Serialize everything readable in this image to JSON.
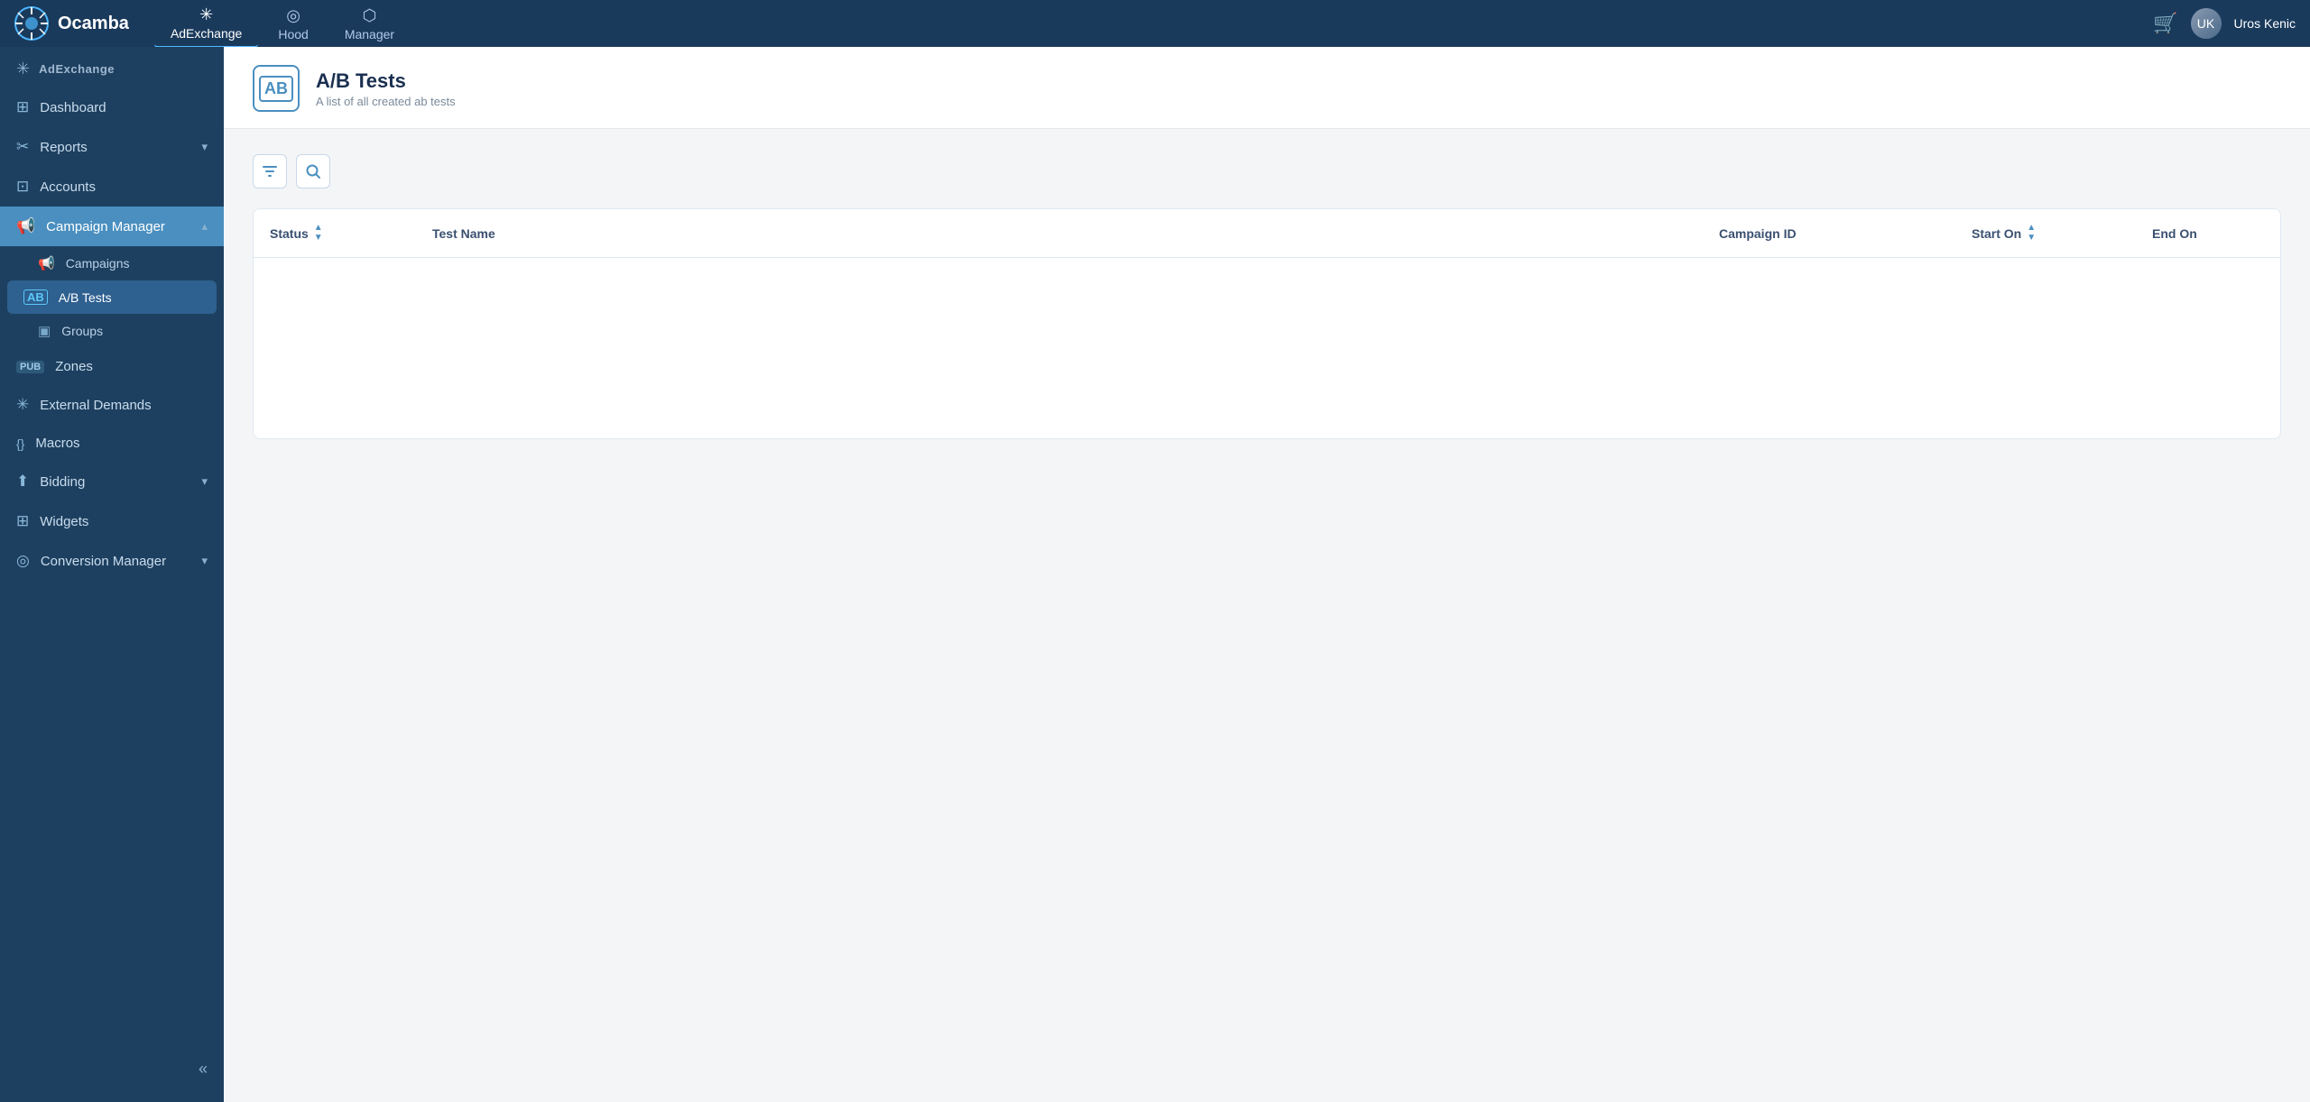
{
  "app": {
    "name": "Ocamba"
  },
  "top_nav": {
    "items": [
      {
        "id": "adexchange",
        "label": "AdExchange",
        "icon": "✳",
        "active": true
      },
      {
        "id": "hood",
        "label": "Hood",
        "icon": "◎"
      },
      {
        "id": "manager",
        "label": "Manager",
        "icon": "⬡"
      }
    ],
    "cart_label": "cart",
    "user_name": "Uros Kenic"
  },
  "sidebar": {
    "section_title": "AdExchange",
    "items": [
      {
        "id": "dashboard",
        "label": "Dashboard",
        "icon": "⊞",
        "active": false
      },
      {
        "id": "reports",
        "label": "Reports",
        "icon": "✂",
        "active": false,
        "has_arrow": true
      },
      {
        "id": "accounts",
        "label": "Accounts",
        "icon": "⊡",
        "active": false
      },
      {
        "id": "campaign-manager",
        "label": "Campaign Manager",
        "icon": "📢",
        "active": true,
        "has_arrow": true,
        "children": [
          {
            "id": "campaigns",
            "label": "Campaigns",
            "icon": "📢"
          },
          {
            "id": "ab-tests",
            "label": "A/B Tests",
            "icon": "AB",
            "active": true
          },
          {
            "id": "groups",
            "label": "Groups",
            "icon": "▣"
          }
        ]
      },
      {
        "id": "zones",
        "label": "Zones",
        "icon": "PUB",
        "active": false
      },
      {
        "id": "external-demands",
        "label": "External Demands",
        "icon": "✳",
        "active": false
      },
      {
        "id": "macros",
        "label": "Macros",
        "icon": "{}",
        "active": false
      },
      {
        "id": "bidding",
        "label": "Bidding",
        "icon": "⬆",
        "active": false,
        "has_arrow": true
      },
      {
        "id": "widgets",
        "label": "Widgets",
        "icon": "⊞",
        "active": false
      },
      {
        "id": "conversion-manager",
        "label": "Conversion Manager",
        "icon": "◎",
        "active": false,
        "has_arrow": true
      }
    ],
    "collapse_label": "«"
  },
  "page": {
    "title": "A/B Tests",
    "subtitle": "A list of all created ab tests",
    "icon": "AB"
  },
  "toolbar": {
    "filter_btn_title": "Filter",
    "search_btn_title": "Search"
  },
  "table": {
    "columns": [
      {
        "id": "status",
        "label": "Status",
        "sortable": true
      },
      {
        "id": "test-name",
        "label": "Test Name",
        "sortable": false
      },
      {
        "id": "campaign-id",
        "label": "Campaign ID",
        "sortable": false
      },
      {
        "id": "start-on",
        "label": "Start On",
        "sortable": true
      },
      {
        "id": "end-on",
        "label": "End On",
        "sortable": false
      }
    ],
    "rows": []
  }
}
